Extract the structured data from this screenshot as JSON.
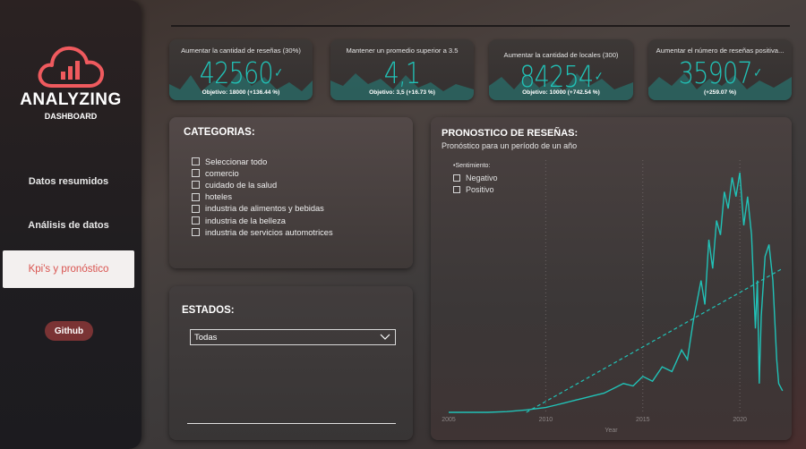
{
  "brand": {
    "title": "ANALYZING",
    "subtitle": "DASHBOARD"
  },
  "nav": {
    "items": [
      {
        "label": "Datos resumidos"
      },
      {
        "label": "Análisis de datos"
      },
      {
        "label": "Kpi's y pronóstico",
        "active": true
      }
    ],
    "github": "Github"
  },
  "colors": {
    "accent": "#21c2b7",
    "brand_red": "#ef5a5e",
    "active_nav_text": "#d9534f"
  },
  "kpis": [
    {
      "title": "Aumentar la cantidad de reseñas (30%)",
      "value": "42560",
      "footer": "Objetivo: 18000 (+136.44 %)"
    },
    {
      "title": "Mantener un promedio superior a 3.5",
      "value": "4,1",
      "footer": "Objetivo: 3,5 (+16.73 %)"
    },
    {
      "title": "Aumentar la cantidad de locales (300)",
      "value": "84254",
      "footer": "Objetivo: 10000 (+742.54 %)"
    },
    {
      "title": "Aumentar el número de reseñas positiva...",
      "value": "35907",
      "footer": "(+259.07 %)"
    }
  ],
  "categorias": {
    "title": "CATEGORIAS:",
    "options": [
      "Seleccionar todo",
      "comercio",
      "cuidado de la salud",
      "hoteles",
      "industria de alimentos y bebidas",
      "industria de la belleza",
      "industria de servicios automotrices"
    ]
  },
  "estados": {
    "title": "ESTADOS:",
    "selected": "Todas"
  },
  "forecast": {
    "title": "PRONOSTICO DE RESEÑAS:",
    "subtitle": "Pronóstico para un período de un año",
    "legend_title": "Sentimiento:",
    "legend_items": [
      "Negativo",
      "Positivo"
    ]
  },
  "chart_data": {
    "type": "line",
    "xlabel": "Year",
    "ylabel": "",
    "x_ticks": [
      "2005",
      "2010",
      "2015",
      "2020"
    ],
    "xlim": [
      2005,
      2022.3
    ],
    "ylim": [
      0,
      1
    ],
    "grid": "vertical dotted",
    "series": [
      {
        "style": "solid",
        "x": [
          2005,
          2006,
          2007,
          2008,
          2009,
          2010,
          2010.5,
          2011,
          2011.5,
          2012,
          2012.5,
          2013,
          2013.5,
          2014,
          2014.5,
          2015,
          2015.5,
          2016,
          2016.5,
          2017,
          2017.3,
          2017.6,
          2018,
          2018.2,
          2018.4,
          2018.6,
          2018.8,
          2019,
          2019.2,
          2019.4,
          2019.6,
          2019.8,
          2020,
          2020.2,
          2020.4,
          2020.6,
          2020.8,
          2020.9,
          2021,
          2021.1,
          2021.3,
          2021.5,
          2021.7,
          2021.9,
          2022,
          2022.2
        ],
        "y": [
          0,
          0,
          0,
          0.003,
          0.01,
          0.02,
          0.03,
          0.04,
          0.05,
          0.06,
          0.07,
          0.08,
          0.1,
          0.12,
          0.11,
          0.15,
          0.13,
          0.19,
          0.17,
          0.26,
          0.22,
          0.38,
          0.55,
          0.45,
          0.72,
          0.6,
          0.8,
          0.74,
          0.92,
          0.85,
          0.98,
          0.9,
          1.0,
          0.78,
          0.9,
          0.74,
          0.35,
          0.55,
          0.12,
          0.4,
          0.65,
          0.7,
          0.55,
          0.22,
          0.12,
          0.09
        ]
      },
      {
        "style": "dashed",
        "x": [
          2009,
          2022.2
        ],
        "y": [
          0.0,
          0.6
        ]
      }
    ]
  }
}
